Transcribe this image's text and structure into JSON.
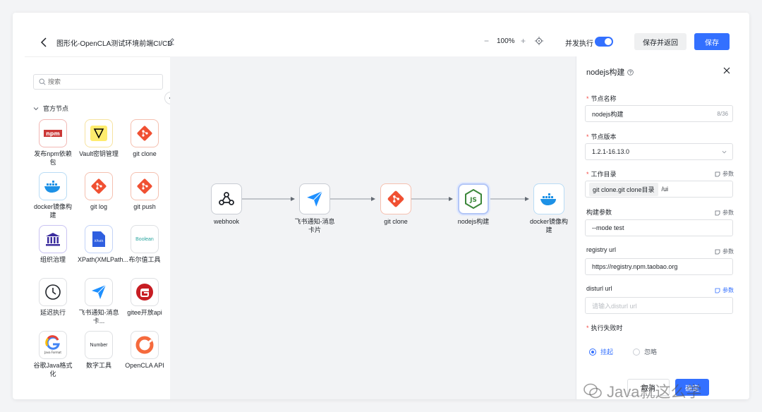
{
  "header": {
    "title": "图形化-OpenCLA测试环境前端CI/CD",
    "zoom_minus": "−",
    "zoom_level": "100%",
    "zoom_plus": "+",
    "concurrent_label": "并发执行",
    "concurrent_on": true,
    "save_return_label": "保存并返回",
    "save_label": "保存"
  },
  "sidebar": {
    "search_placeholder": "搜索",
    "section_title": "官方节点",
    "nodes": [
      {
        "label": "发布npm依赖包",
        "icon": "npm-icon"
      },
      {
        "label": "Vault密钥管理",
        "icon": "vault-icon"
      },
      {
        "label": "git clone",
        "icon": "git-icon"
      },
      {
        "label": "docker镜像构建",
        "icon": "docker-icon"
      },
      {
        "label": "git log",
        "icon": "git-icon"
      },
      {
        "label": "git push",
        "icon": "git-icon"
      },
      {
        "label": "组织治理",
        "icon": "institution-icon"
      },
      {
        "label": "XPath(XMLPath...",
        "icon": "xpath-icon",
        "badge": "XPath"
      },
      {
        "label": "布尔值工具",
        "icon": "boolean-icon",
        "badge": "Boolean"
      },
      {
        "label": "延迟执行",
        "icon": "clock-icon"
      },
      {
        "label": "飞书通知-消息卡...",
        "icon": "feishu-icon"
      },
      {
        "label": "gitee开放api",
        "icon": "gitee-icon"
      },
      {
        "label": "谷歌Java格式化",
        "icon": "google-java-icon",
        "badge": "Java Format"
      },
      {
        "label": "数字工具",
        "icon": "number-icon",
        "badge": "Number"
      },
      {
        "label": "OpenCLA API",
        "icon": "opencla-icon"
      }
    ]
  },
  "canvas": {
    "nodes": [
      {
        "label": "webhook",
        "icon": "webhook-icon"
      },
      {
        "label": "飞书通知-消息卡片",
        "icon": "feishu-icon"
      },
      {
        "label": "git clone",
        "icon": "git-icon"
      },
      {
        "label": "nodejs构建",
        "icon": "nodejs-icon",
        "active": true
      },
      {
        "label": "docker镜像构建",
        "icon": "docker-icon"
      }
    ]
  },
  "panel": {
    "title": "nodejs构建",
    "name_label": "节点名称",
    "name_value": "nodejs构建",
    "name_count": "8/36",
    "version_label": "节点版本",
    "version_value": "1.2.1-16.13.0",
    "workdir_label": "工作目录",
    "workdir_chip": "git clone.git clone目录",
    "workdir_value": "/ui",
    "build_args_label": "构建参数",
    "build_args_value": "--mode test",
    "registry_label": "registry url",
    "registry_value": "https://registry.npm.taobao.org",
    "disturl_label": "disturl url",
    "disturl_placeholder": "请输入disturl url",
    "param_link": "参数",
    "fail_label": "执行失败时",
    "fail_opt_hang": "挂起",
    "fail_opt_ignore": "忽略",
    "cancel_label": "取消",
    "ok_label": "确定"
  },
  "watermark": "Java就这么学",
  "colors": {
    "accent": "#3370ff",
    "canvas_bg": "#f2f3f5",
    "required": "#f54a45"
  }
}
